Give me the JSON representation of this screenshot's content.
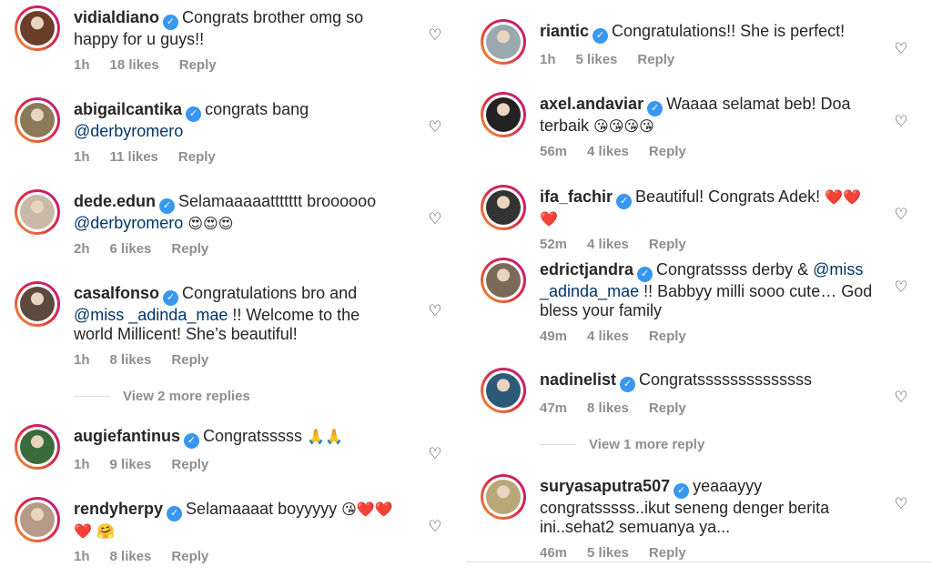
{
  "left": [
    {
      "user": "vidialdiano",
      "text": "Congrats brother omg so happy for u guys!!",
      "time": "1h",
      "likes": "18 likes",
      "reply": "Reply",
      "avatar_color": "#6b3e2a"
    },
    {
      "user": "abigailcantika",
      "text": "congrats bang",
      "mention": "@derbyromero",
      "time": "1h",
      "likes": "11 likes",
      "reply": "Reply",
      "avatar_color": "#8a7a5a"
    },
    {
      "user": "dede.edun",
      "text": "Selamaaaaattttttt broooooo",
      "mention": "@derbyromero",
      "emoji": "😍😍😍",
      "time": "2h",
      "likes": "6 likes",
      "reply": "Reply",
      "avatar_color": "#c9b9a9"
    },
    {
      "user": "casalfonso",
      "text1": "Congratulations bro and",
      "mention": "@miss _adinda_mae",
      "text2": "!! Welcome to the world Millicent! She’s beautiful!",
      "time": "1h",
      "likes": "8 likes",
      "reply": "Reply",
      "avatar_color": "#5c4a3e",
      "more": "View 2 more replies"
    },
    {
      "user": "augiefantinus",
      "text": "Congratsssss",
      "emoji": "🙏🙏",
      "time": "1h",
      "likes": "9 likes",
      "reply": "Reply",
      "avatar_color": "#3a6b3a"
    },
    {
      "user": "rendyherpy",
      "text": "Selamaaaat boyyyyy",
      "emoji": "😘❤️❤️❤️ 🤗",
      "time": "1h",
      "likes": "8 likes",
      "reply": "Reply",
      "avatar_color": "#b59a88"
    }
  ],
  "right": [
    {
      "user": "riantic",
      "text": "Congratulations!! She is perfect!",
      "time": "1h",
      "likes": "5 likes",
      "reply": "Reply",
      "avatar_color": "#9aa8b0"
    },
    {
      "user": "axel.andaviar",
      "text": "Waaaa selamat beb! Doa terbaik",
      "emoji": "😘😘😘😘",
      "time": "56m",
      "likes": "4 likes",
      "reply": "Reply",
      "avatar_color": "#222222"
    },
    {
      "user": "ifa_fachir",
      "text": "Beautiful! Congrats Adek!",
      "emoji": "❤️❤️❤️",
      "time": "52m",
      "likes": "4 likes",
      "reply": "Reply",
      "avatar_color": "#333333"
    },
    {
      "user": "edrictjandra",
      "text1": "Congratssss derby &",
      "mention": "@miss _adinda_mae",
      "text2": "!! Babbyy milli sooo cute… God bless your family",
      "time": "49m",
      "likes": "4 likes",
      "reply": "Reply",
      "avatar_color": "#7a6a5a"
    },
    {
      "user": "nadinelist",
      "text": "Congratssssssssssssss",
      "time": "47m",
      "likes": "8 likes",
      "reply": "Reply",
      "avatar_color": "#2e5a7a",
      "more": "View 1 more reply"
    },
    {
      "user": "suryasaputra507",
      "text": "yeaaayyy congratsssss..ikut seneng denger berita ini..sehat2 semuanya ya...",
      "time": "46m",
      "likes": "5 likes",
      "reply": "Reply",
      "avatar_color": "#b8a878"
    }
  ],
  "badge_glyph": "✓",
  "heart_glyph": "♡"
}
